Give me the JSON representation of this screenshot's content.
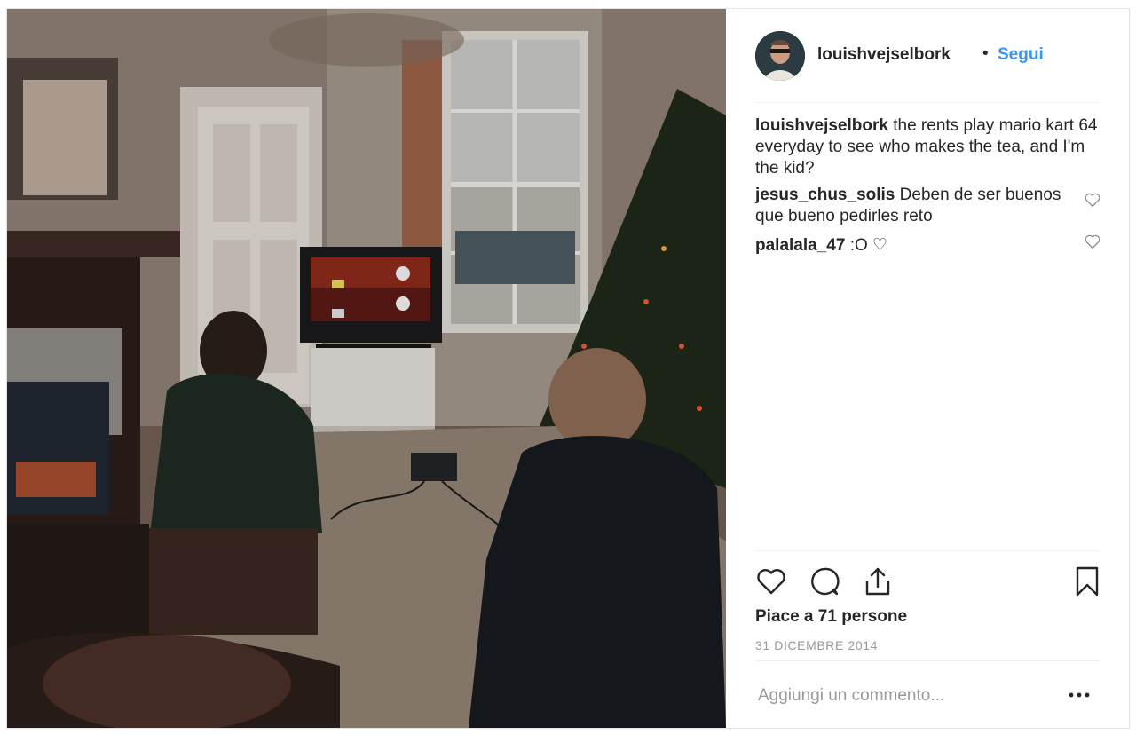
{
  "post": {
    "username": "louishvejselbork",
    "dot": "•",
    "follow_label": "Segui",
    "caption": {
      "user": "louishvejselbork",
      "text": "the rents play mario kart 64 everyday to see who makes the tea, and I'm the kid?"
    },
    "comments": [
      {
        "user": "jesus_chus_solis",
        "text": "Deben de ser buenos que bueno pedirles reto"
      },
      {
        "user": "palalala_47",
        "text": ":O ♡"
      }
    ],
    "likes": "Piace a 71 persone",
    "date": "31 DICEMBRE 2014",
    "comment_placeholder": "Aggiungi un commento..."
  },
  "icons": {
    "like": "heart-icon",
    "comment": "comment-bubble-icon",
    "share": "share-icon",
    "save": "bookmark-icon",
    "comment_like": "heart-outline-icon",
    "more": "more-options-icon"
  },
  "colors": {
    "link": "#3897f0",
    "text": "#262626",
    "muted": "#999999",
    "divider": "#efefef"
  }
}
